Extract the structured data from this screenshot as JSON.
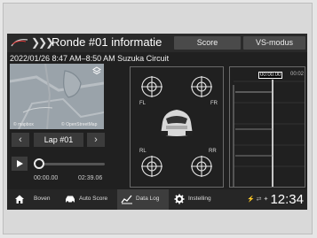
{
  "header": {
    "title": "Ronde #01 informatie",
    "tab_score": "Score",
    "tab_vs": "VS-modus"
  },
  "session": {
    "info": "2022/01/26 8:47 AM–8:50 AM Suzuka Circuit"
  },
  "map": {
    "icon": "layers-icon"
  },
  "lap": {
    "label": "Lap #01",
    "prev": "‹",
    "next": "›",
    "time_start": "00:00.00",
    "time_end": "02:39.06",
    "progress": 0.0
  },
  "tyres": {
    "fl": "FL",
    "fr": "FR",
    "rl": "RL",
    "rr": "RR"
  },
  "graph": {
    "time_label": "00:00.00",
    "time_label2": "00:02"
  },
  "bottom": {
    "home": "Boven",
    "auto_score": "Auto Score",
    "data_log": "Data Log",
    "settings": "Instelling",
    "clock": "12:34"
  },
  "colors": {
    "accent": "#ffffff",
    "bg": "#202020",
    "button": "#4a4a4a"
  }
}
